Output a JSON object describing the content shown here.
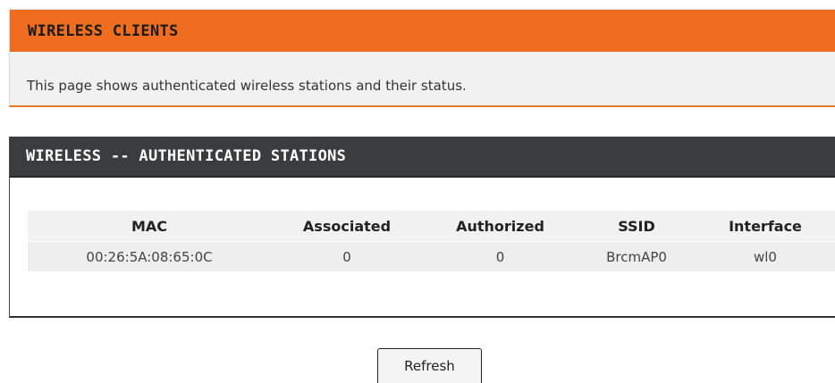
{
  "wireless_clients": {
    "title": "WIRELESS CLIENTS",
    "description": "This page shows authenticated wireless stations and their status."
  },
  "stations": {
    "title": "WIRELESS -- AUTHENTICATED STATIONS",
    "columns": [
      "MAC",
      "Associated",
      "Authorized",
      "SSID",
      "Interface"
    ],
    "rows": [
      {
        "mac": "00:26:5A:08:65:0C",
        "associated": "0",
        "authorized": "0",
        "ssid": "BrcmAP0",
        "interface": "wl0"
      }
    ]
  },
  "actions": {
    "refresh_label": "Refresh"
  },
  "colors": {
    "orange_header": "#ee6d1e",
    "dark_header": "#3b3c3d",
    "panel_background": "#f1f1f1"
  }
}
